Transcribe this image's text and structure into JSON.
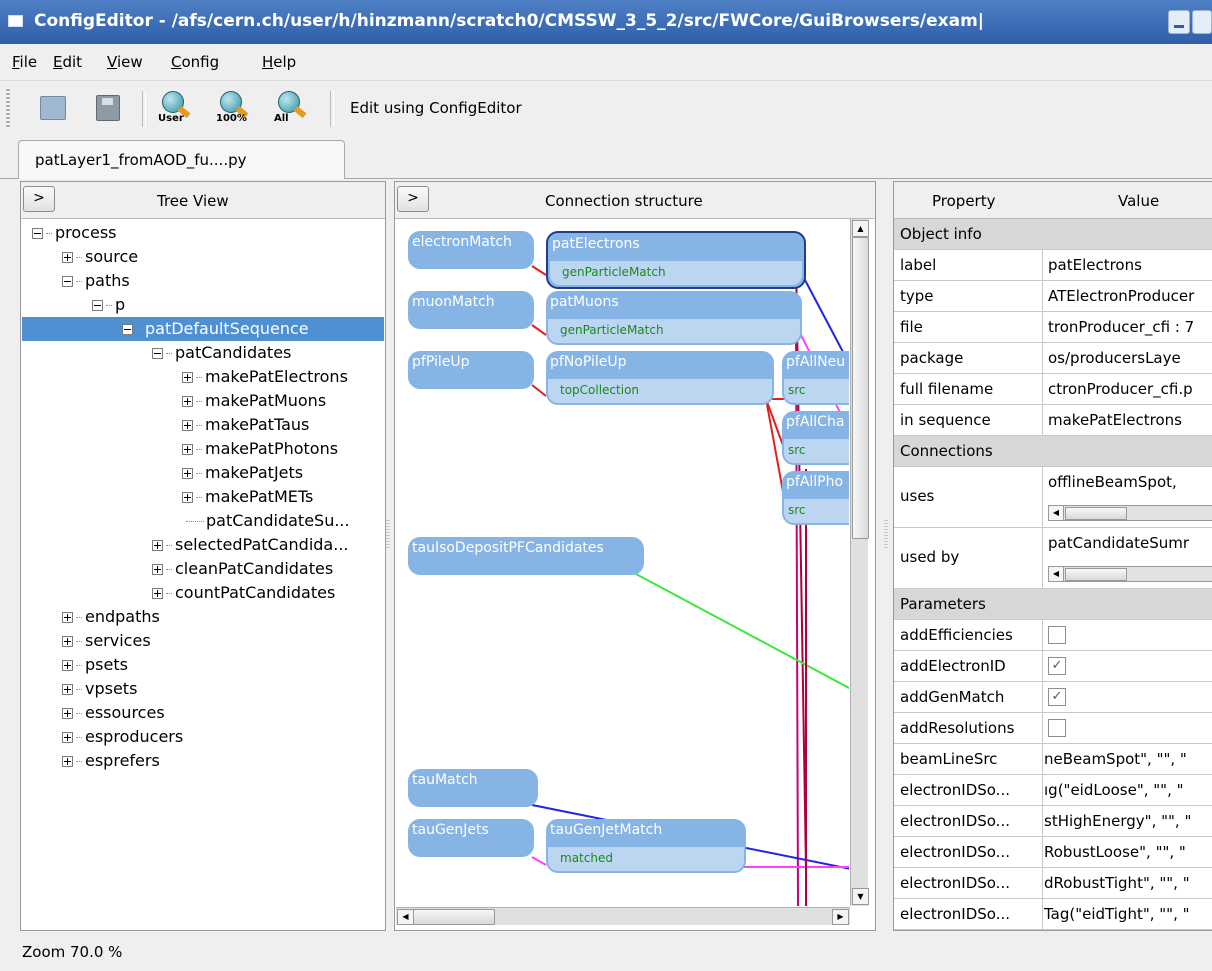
{
  "window": {
    "title": "ConfigEditor - /afs/cern.ch/user/h/hinzmann/scratch0/CMSSW_3_5_2/src/FWCore/GuiBrowsers/exam|"
  },
  "menu": [
    {
      "label": "File",
      "mnemonic": "F",
      "rest": "ile"
    },
    {
      "label": "Edit",
      "mnemonic": "E",
      "rest": "dit"
    },
    {
      "label": "View",
      "mnemonic": "V",
      "rest": "iew"
    },
    {
      "label": "Config",
      "mnemonic": "C",
      "rest": "onfig"
    },
    {
      "label": "Help",
      "mnemonic": "H",
      "rest": "elp"
    }
  ],
  "toolbar": {
    "zoom_user": "User",
    "zoom_100": "100%",
    "zoom_all": "All",
    "edit_text": "Edit using ConfigEditor"
  },
  "tab": {
    "label": "patLayer1_fromAOD_fu....py"
  },
  "tree_panel": {
    "toggle": ">",
    "title": "Tree View",
    "nodes": [
      {
        "label": "process"
      },
      {
        "label": "source"
      },
      {
        "label": "paths"
      },
      {
        "label": "p"
      },
      {
        "label": "patDefaultSequence"
      },
      {
        "label": "patCandidates"
      },
      {
        "label": "makePatElectrons"
      },
      {
        "label": "makePatMuons"
      },
      {
        "label": "makePatTaus"
      },
      {
        "label": "makePatPhotons"
      },
      {
        "label": "makePatJets"
      },
      {
        "label": "makePatMETs"
      },
      {
        "label": "patCandidateSu..."
      },
      {
        "label": "selectedPatCandida..."
      },
      {
        "label": "cleanPatCandidates"
      },
      {
        "label": "countPatCandidates"
      },
      {
        "label": "endpaths"
      },
      {
        "label": "services"
      },
      {
        "label": "psets"
      },
      {
        "label": "vpsets"
      },
      {
        "label": "essources"
      },
      {
        "label": "esproducers"
      },
      {
        "label": "esprefers"
      }
    ]
  },
  "graph_panel": {
    "toggle": ">",
    "title": "Connection structure",
    "nodes": {
      "electronMatch": "electronMatch",
      "patElectrons": "patElectrons",
      "patElectrons_port": "genParticleMatch",
      "muonMatch": "muonMatch",
      "patMuons": "patMuons",
      "patMuons_port": "genParticleMatch",
      "pfPileUp": "pfPileUp",
      "pfNoPileUp": "pfNoPileUp",
      "pfNoPileUp_port": "topCollection",
      "pfAllNeu": "pfAllNeu",
      "pfAllNeu_port": "src",
      "pfAllCha": "pfAllCha",
      "pfAllCha_port": "src",
      "pfAllPho": "pfAllPho",
      "pfAllPho_port": "src",
      "tauIso": "tauIsoDepositPFCandidates",
      "tauMatch": "tauMatch",
      "tauGenJets": "tauGenJets",
      "tauGenJetMatch": "tauGenJetMatch",
      "tauGenJetMatch_port": "matched"
    }
  },
  "properties": {
    "header_property": "Property",
    "header_value": "Value",
    "object_info": "Object info",
    "rows": [
      {
        "key": "label",
        "value": "patElectrons"
      },
      {
        "key": "type",
        "value": "ATElectronProducer"
      },
      {
        "key": "file",
        "value": "tronProducer_cfi : 7"
      },
      {
        "key": "package",
        "value": "os/producersLaye"
      },
      {
        "key": "full filename",
        "value": "ctronProducer_cfi.p"
      },
      {
        "key": "in sequence",
        "value": "makePatElectrons"
      }
    ],
    "connections": "Connections",
    "uses_key": "uses",
    "uses_value": "offlineBeamSpot,",
    "usedby_key": "used by",
    "usedby_value": "patCandidateSumr",
    "parameters": "Parameters",
    "checks": [
      {
        "key": "addEfficiencies",
        "checked": false
      },
      {
        "key": "addElectronID",
        "checked": true
      },
      {
        "key": "addGenMatch",
        "checked": true
      },
      {
        "key": "addResolutions",
        "checked": false
      }
    ],
    "params": [
      {
        "key": "beamLineSrc",
        "value": "neBeamSpot\", \"\", \""
      },
      {
        "key": "electronIDSo...",
        "value": "ıg(\"eidLoose\", \"\", \""
      },
      {
        "key": "electronIDSo...",
        "value": "stHighEnergy\", \"\", \""
      },
      {
        "key": "electronIDSo...",
        "value": "RobustLoose\", \"\", \""
      },
      {
        "key": "electronIDSo...",
        "value": "dRobustTight\", \"\", \""
      },
      {
        "key": "electronIDSo...",
        "value": "Tag(\"eidTight\", \"\", \""
      }
    ]
  },
  "status": {
    "zoom": "Zoom 70.0 %"
  },
  "colors": {
    "selection": "#4f8fd3",
    "node": "#86b4e4",
    "title_bar": "#2f5fa8"
  }
}
